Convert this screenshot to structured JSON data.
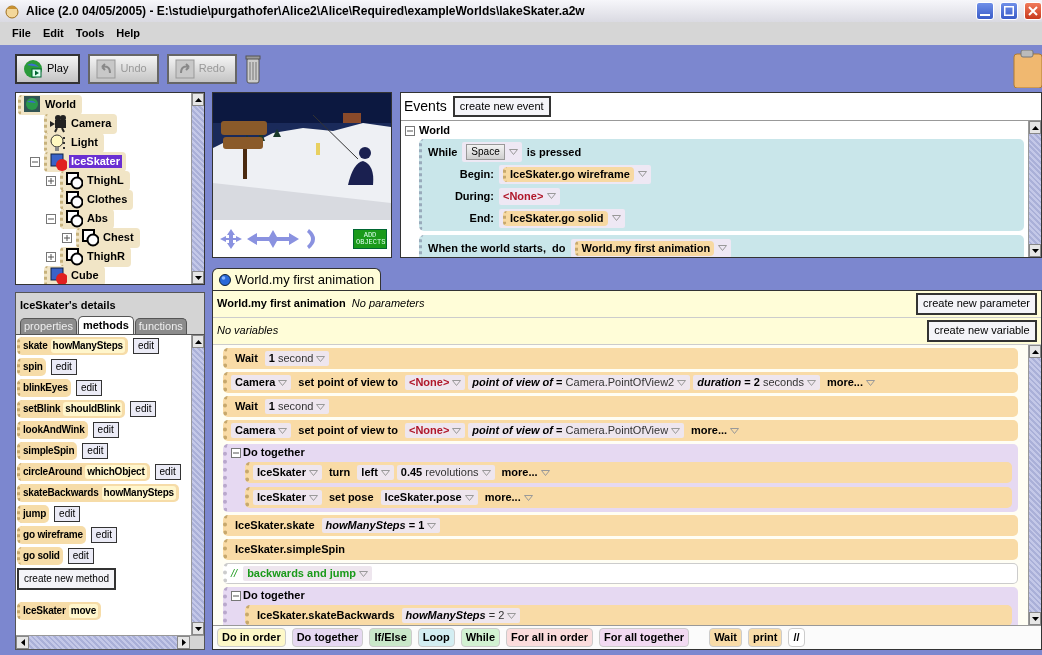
{
  "window": {
    "title": "Alice (2.0 04/05/2005) - E:\\studie\\purgathofer\\Alice2\\Alice\\Required\\exampleWorlds\\lakeSkater.a2w"
  },
  "menu": [
    "File",
    "Edit",
    "Tools",
    "Help"
  ],
  "toolbar": [
    {
      "label": "Play",
      "kind": "play",
      "disabled": false
    },
    {
      "label": "Undo",
      "kind": "undo",
      "disabled": true
    },
    {
      "label": "Redo",
      "kind": "redo",
      "disabled": true
    }
  ],
  "object_tree": [
    {
      "name": "World",
      "kind": "world",
      "selected": false,
      "children": [
        {
          "name": "Camera",
          "kind": "camera",
          "selected": false
        },
        {
          "name": "Light",
          "kind": "light",
          "selected": false
        },
        {
          "name": "IceSkater",
          "kind": "object",
          "selected": true,
          "expanded": true,
          "children": [
            {
              "name": "ThighL",
              "kind": "part",
              "selected": false,
              "expanded": false
            },
            {
              "name": "Clothes",
              "kind": "part",
              "selected": false
            },
            {
              "name": "Abs",
              "kind": "part",
              "selected": false,
              "expanded": true,
              "children": [
                {
                  "name": "Chest",
                  "kind": "part",
                  "selected": false,
                  "expanded": false
                }
              ]
            },
            {
              "name": "ThighR",
              "kind": "part",
              "selected": false,
              "expanded": false
            }
          ]
        },
        {
          "name": "Cube",
          "kind": "object",
          "selected": false
        }
      ]
    }
  ],
  "view": {
    "add_objects": "ADD OBJECTS"
  },
  "events": {
    "title": "Events",
    "create_button": "create new event",
    "group": "World",
    "expanded": true,
    "items": [
      {
        "kind": "while",
        "keyword": "While",
        "key": "Space",
        "suffix": "is pressed",
        "rows": [
          {
            "label": "Begin:",
            "kind": "method",
            "value": "IceSkater.go wireframe"
          },
          {
            "label": "During:",
            "kind": "none",
            "value": "<None>"
          },
          {
            "label": "End:",
            "kind": "method",
            "value": "IceSkater.go solid"
          }
        ]
      },
      {
        "kind": "when",
        "label": "When the world starts,  do",
        "value": "World.my first animation"
      }
    ]
  },
  "details": {
    "title": "IceSkater's details",
    "tabs": [
      {
        "label": "properties",
        "selected": false
      },
      {
        "label": "methods",
        "selected": true
      },
      {
        "label": "functions",
        "selected": false
      }
    ],
    "methods": [
      {
        "name": "skate",
        "param": "howManySteps",
        "edit": "edit"
      },
      {
        "name": "spin",
        "edit": "edit"
      },
      {
        "name": "blinkEyes",
        "edit": "edit"
      },
      {
        "name": "setBlink",
        "param": "shouldBlink",
        "edit": "edit"
      },
      {
        "name": "lookAndWink",
        "edit": "edit"
      },
      {
        "name": "simpleSpin",
        "edit": "edit"
      },
      {
        "name": "circleAround",
        "param": "whichObject",
        "edit": "edit"
      },
      {
        "name": "skateBackwards",
        "param": "howManySteps"
      },
      {
        "name": "jump",
        "edit": "edit"
      },
      {
        "name": "go wireframe",
        "edit": "edit"
      },
      {
        "name": "go solid",
        "edit": "edit"
      }
    ],
    "create_button": "create new method",
    "tiles": [
      {
        "name": "IceSkater",
        "param": "move"
      }
    ]
  },
  "editor": {
    "tab": "World.my first animation",
    "method_name": "World.my first animation",
    "parameters": "No parameters",
    "create_parameter": "create new parameter",
    "variables": "No variables",
    "create_variable": "create new variable",
    "statements": [
      {
        "kind": "statement",
        "parts": [
          {
            "kind": "word",
            "text": "Wait"
          },
          {
            "kind": "value",
            "text": "**1** second"
          }
        ]
      },
      {
        "kind": "statement",
        "parts": [
          {
            "kind": "drop",
            "text": "Camera"
          },
          {
            "kind": "word",
            "text": "set point of view to"
          },
          {
            "kind": "none",
            "text": "<None>"
          },
          {
            "kind": "value",
            "text": "*point of view of* **=** Camera.PointOfView2"
          },
          {
            "kind": "value",
            "text": "*duration* **= 2** seconds"
          },
          {
            "kind": "more",
            "text": "more..."
          }
        ]
      },
      {
        "kind": "statement",
        "parts": [
          {
            "kind": "word",
            "text": "Wait"
          },
          {
            "kind": "value",
            "text": "**1** second"
          }
        ]
      },
      {
        "kind": "statement",
        "parts": [
          {
            "kind": "drop",
            "text": "Camera"
          },
          {
            "kind": "word",
            "text": "set point of view to"
          },
          {
            "kind": "none",
            "text": "<None>"
          },
          {
            "kind": "value",
            "text": "*point of view of* **=** Camera.PointOfView"
          },
          {
            "kind": "more",
            "text": "more..."
          }
        ]
      },
      {
        "kind": "group",
        "title": "Do together",
        "expanded": true,
        "children": [
          {
            "kind": "statement",
            "parts": [
              {
                "kind": "drop",
                "text": "IceSkater"
              },
              {
                "kind": "word",
                "text": "turn"
              },
              {
                "kind": "drop",
                "text": "left"
              },
              {
                "kind": "value",
                "text": "**0.45** revolutions"
              },
              {
                "kind": "more",
                "text": "more..."
              }
            ]
          },
          {
            "kind": "statement",
            "parts": [
              {
                "kind": "drop",
                "text": "IceSkater"
              },
              {
                "kind": "word",
                "text": "set pose"
              },
              {
                "kind": "drop",
                "text": "IceSkater.pose"
              },
              {
                "kind": "more",
                "text": "more..."
              }
            ]
          }
        ]
      },
      {
        "kind": "statement",
        "parts": [
          {
            "kind": "word",
            "text": "IceSkater.skate"
          },
          {
            "kind": "value",
            "text": "*howManySteps* **= 1**"
          }
        ]
      },
      {
        "kind": "statement",
        "parts": [
          {
            "kind": "word",
            "text": "IceSkater.simpleSpin"
          }
        ]
      },
      {
        "kind": "comment",
        "marker": "//",
        "text": "backwards and jump"
      },
      {
        "kind": "group",
        "title": "Do together",
        "expanded": true,
        "children": [
          {
            "kind": "statement",
            "parts": [
              {
                "kind": "word",
                "text": "IceSkater.skateBackwards"
              },
              {
                "kind": "value",
                "text": "*howManySteps* = 2"
              }
            ]
          }
        ]
      }
    ],
    "palette": [
      {
        "label": "Do in order",
        "color": "#fdf8c8"
      },
      {
        "label": "Do together",
        "color": "#e6d8f2"
      },
      {
        "label": "If/Else",
        "color": "#c9e8c9"
      },
      {
        "label": "Loop",
        "color": "#d3eef2"
      },
      {
        "label": "While",
        "color": "#d2f2d2"
      },
      {
        "label": "For all in order",
        "color": "#fbdcdc"
      },
      {
        "label": "For all together",
        "color": "#f2daf2"
      },
      {
        "label": "Wait",
        "color": "#f9dca8"
      },
      {
        "label": "print",
        "color": "#f9dca8"
      },
      {
        "label": "//",
        "color": "#ffffff"
      }
    ]
  }
}
